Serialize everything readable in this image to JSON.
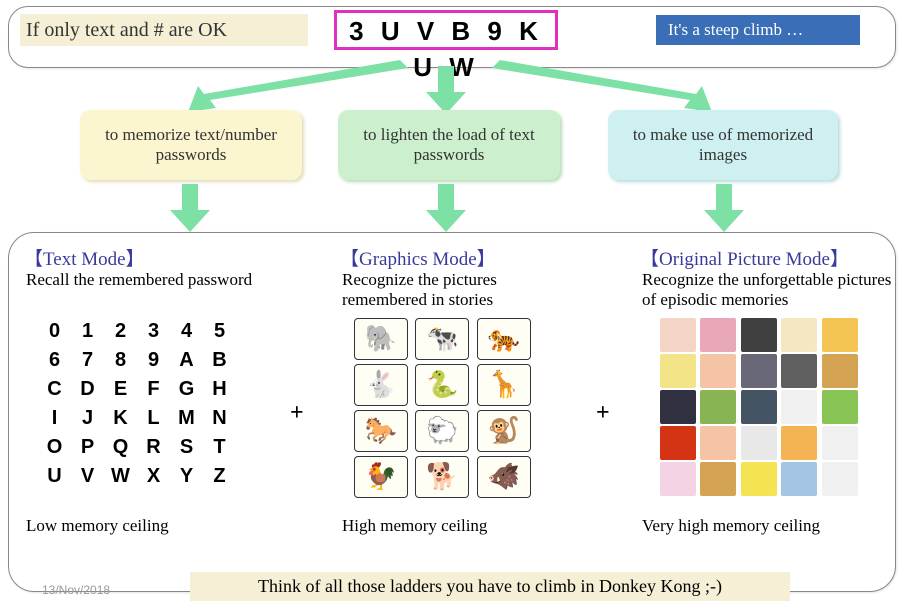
{
  "top": {
    "ok_label": "If only text and # are OK",
    "captcha": "3 U V B 9 K U W",
    "steep": "It's a steep climb …"
  },
  "mid": {
    "box1": "to memorize text/number passwords",
    "box2": "to lighten the load of text passwords",
    "box3": "to make use of memorized images"
  },
  "modes": {
    "text": {
      "title": "【Text Mode】",
      "desc": "Recall the remembered password",
      "ceiling": "Low memory ceiling",
      "chars": [
        "0",
        "1",
        "2",
        "3",
        "4",
        "5",
        "6",
        "7",
        "8",
        "9",
        "A",
        "B",
        "C",
        "D",
        "E",
        "F",
        "G",
        "H",
        "I",
        "J",
        "K",
        "L",
        "M",
        "N",
        "O",
        "P",
        "Q",
        "R",
        "S",
        "T",
        "U",
        "V",
        "W",
        "X",
        "Y",
        "Z"
      ]
    },
    "graphics": {
      "title": "【Graphics Mode】",
      "desc": "Recognize the pictures remembered in stories",
      "ceiling": "High memory ceiling",
      "emoji": [
        "🐘",
        "🐄",
        "🐅",
        "🐇",
        "🐍",
        "🦒",
        "🐎",
        "🐑",
        "🐒",
        "🐓",
        "🐕",
        "🐗"
      ]
    },
    "original": {
      "title": "【Original Picture Mode】",
      "desc": "Recognize the unforgettable pictures of episodic memories",
      "ceiling": "Very high memory ceiling",
      "colors": [
        "#f4d4c4",
        "#e8a8b8",
        "#404040",
        "#f4e8c4",
        "#f4c454",
        "#f4e488",
        "#f4c4a4",
        "#686878",
        "#606060",
        "#d4a454",
        "#303040",
        "#88b454",
        "#445464",
        "#f0f0f0",
        "#88c454",
        "#d43414",
        "#f4c4a4",
        "#e8e8e8",
        "#f4b454",
        "#f0f0f0",
        "#f4d4e4",
        "#d4a454",
        "#f4e454",
        "#a4c4e4",
        "#f0f0f0"
      ]
    }
  },
  "plus": "+",
  "footer": {
    "date": "13/Nov/2018",
    "text": "Think of all those ladders you have to climb in Donkey Kong ;-)"
  }
}
